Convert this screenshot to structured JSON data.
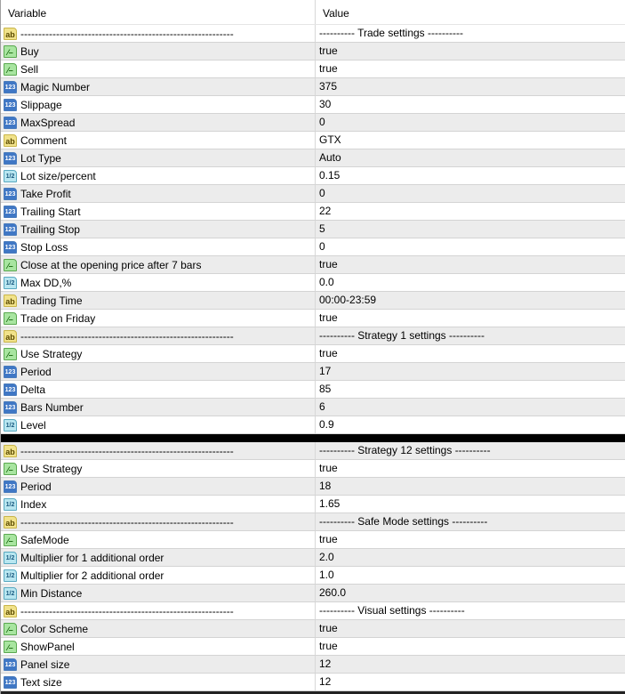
{
  "header": {
    "variable": "Variable",
    "value": "Value"
  },
  "icons": {
    "str": "ab",
    "bool": "bool-icon",
    "int": "123",
    "dbl": "1/2"
  },
  "top_rows": [
    {
      "type": "str",
      "name": "------------------------------------------------------------",
      "value": "---------- Trade settings ----------"
    },
    {
      "type": "bool",
      "name": "Buy",
      "value": "true"
    },
    {
      "type": "bool",
      "name": "Sell",
      "value": "true"
    },
    {
      "type": "int",
      "name": "Magic Number",
      "value": "375"
    },
    {
      "type": "int",
      "name": "Slippage",
      "value": "30"
    },
    {
      "type": "int",
      "name": "MaxSpread",
      "value": "0"
    },
    {
      "type": "str",
      "name": "Comment",
      "value": "GTX"
    },
    {
      "type": "int",
      "name": "Lot Type",
      "value": "Auto"
    },
    {
      "type": "dbl",
      "name": "Lot size/percent",
      "value": "0.15"
    },
    {
      "type": "int",
      "name": "Take Profit",
      "value": "0"
    },
    {
      "type": "int",
      "name": "Trailing Start",
      "value": "22"
    },
    {
      "type": "int",
      "name": "Trailing Stop",
      "value": "5"
    },
    {
      "type": "int",
      "name": "Stop Loss",
      "value": "0"
    },
    {
      "type": "bool",
      "name": "Close at the opening price after 7 bars",
      "value": "true"
    },
    {
      "type": "dbl",
      "name": "Max DD,%",
      "value": "0.0"
    },
    {
      "type": "str",
      "name": "Trading Time",
      "value": "00:00-23:59"
    },
    {
      "type": "bool",
      "name": "Trade on Friday",
      "value": "true"
    },
    {
      "type": "str",
      "name": "------------------------------------------------------------",
      "value": "---------- Strategy 1 settings ----------"
    },
    {
      "type": "bool",
      "name": "Use Strategy",
      "value": "true"
    },
    {
      "type": "int",
      "name": "Period",
      "value": "17"
    },
    {
      "type": "int",
      "name": "Delta",
      "value": "85"
    },
    {
      "type": "int",
      "name": "Bars Number",
      "value": "6"
    },
    {
      "type": "dbl",
      "name": "Level",
      "value": "0.9"
    }
  ],
  "bottom_rows": [
    {
      "type": "str",
      "name": "------------------------------------------------------------",
      "value": "---------- Strategy 12 settings ----------"
    },
    {
      "type": "bool",
      "name": "Use Strategy",
      "value": "true"
    },
    {
      "type": "int",
      "name": "Period",
      "value": "18"
    },
    {
      "type": "dbl",
      "name": "Index",
      "value": "1.65"
    },
    {
      "type": "str",
      "name": "------------------------------------------------------------",
      "value": "---------- Safe Mode settings ----------"
    },
    {
      "type": "bool",
      "name": "SafeMode",
      "value": "true"
    },
    {
      "type": "dbl",
      "name": "Multiplier for 1 additional order",
      "value": "2.0"
    },
    {
      "type": "dbl",
      "name": "Multiplier for 2 additional order",
      "value": "1.0"
    },
    {
      "type": "dbl",
      "name": "Min Distance",
      "value": "260.0"
    },
    {
      "type": "str",
      "name": "------------------------------------------------------------",
      "value": "---------- Visual settings ----------"
    },
    {
      "type": "bool",
      "name": "Color Scheme",
      "value": "true"
    },
    {
      "type": "bool",
      "name": "ShowPanel",
      "value": "true"
    },
    {
      "type": "int",
      "name": "Panel size",
      "value": "12"
    },
    {
      "type": "int",
      "name": "Text size",
      "value": "12"
    }
  ]
}
